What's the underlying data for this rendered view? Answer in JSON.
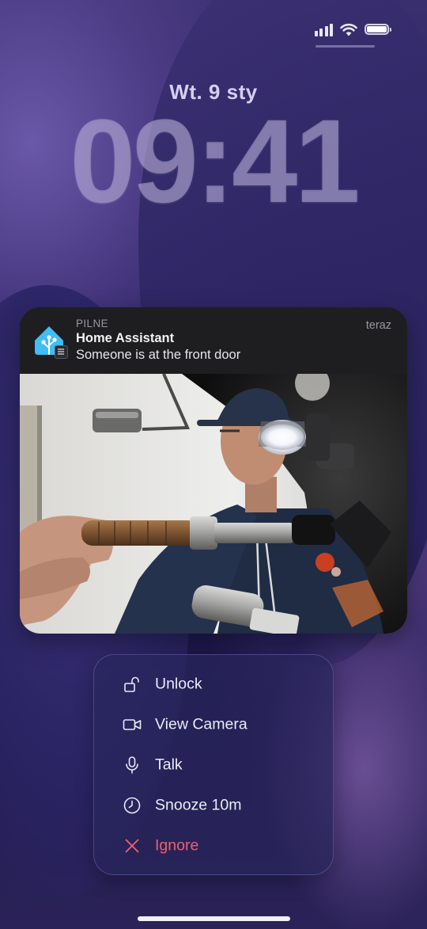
{
  "status": {
    "signal_icon": "cellular-signal-icon",
    "wifi_icon": "wifi-icon",
    "battery_icon": "battery-icon",
    "battery_level": 1.0
  },
  "lockscreen": {
    "date": "Wt. 9 sty",
    "time": "09:41"
  },
  "notification": {
    "category": "PILNE",
    "app_name": "Home Assistant",
    "message": "Someone is at the front door",
    "time": "teraz",
    "app_icon": "home-assistant-icon",
    "image": "doorbell-camera-snapshot"
  },
  "actions": [
    {
      "label": "Unlock",
      "icon": "unlock-icon",
      "color": "#eceaf6"
    },
    {
      "label": "View Camera",
      "icon": "video-camera-icon",
      "color": "#eceaf6"
    },
    {
      "label": "Talk",
      "icon": "microphone-icon",
      "color": "#eceaf6"
    },
    {
      "label": "Snooze 10m",
      "icon": "clock-icon",
      "color": "#eceaf6"
    },
    {
      "label": "Ignore",
      "icon": "close-icon",
      "color": "#f0606c"
    }
  ],
  "colors": {
    "accent_blue": "#41bdf5",
    "danger": "#f0606c"
  }
}
